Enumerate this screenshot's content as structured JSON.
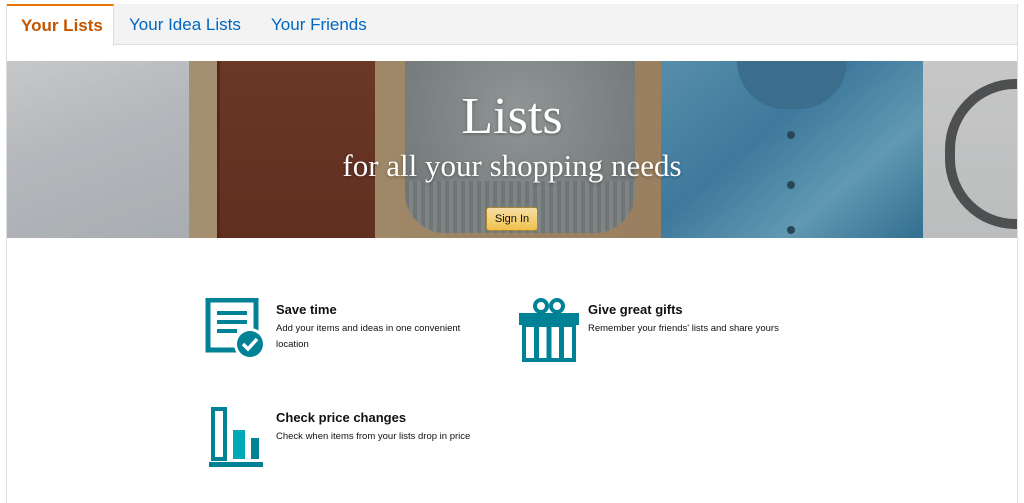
{
  "tabs": [
    {
      "label": "Your Lists",
      "active": true
    },
    {
      "label": "Your Idea Lists",
      "active": false
    },
    {
      "label": "Your Friends",
      "active": false
    }
  ],
  "hero": {
    "title": "Lists",
    "subtitle": "for all your shopping needs",
    "signin_label": "Sign In"
  },
  "features": [
    {
      "icon": "list-check-icon",
      "title": "Save time",
      "description": "Add your items and ideas in one convenient location"
    },
    {
      "icon": "gift-icon",
      "title": "Give great gifts",
      "description": "Remember your friends' lists and share yours"
    },
    {
      "icon": "price-chart-icon",
      "title": "Check price changes",
      "description": "Check when items from your lists drop in price"
    }
  ],
  "colors": {
    "accent_teal": "#008296",
    "active_tab": "#c45500",
    "link_blue": "#0066c0",
    "button_yellow": "#f0c14b"
  }
}
